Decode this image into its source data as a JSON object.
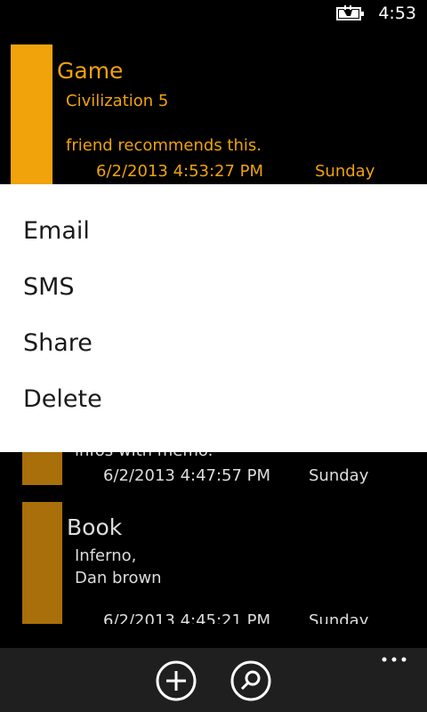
{
  "status": {
    "time": "4:53",
    "battery_icon": "battery-charging-icon"
  },
  "entries": [
    {
      "title": "Game",
      "text": "Civilization 5\n\nfriend recommends this.",
      "date": "6/2/2013 4:53:27 PM",
      "day": "Sunday",
      "color": "#F0A30A"
    },
    {
      "text": "infos with memo.",
      "date": "6/2/2013 4:47:57 PM",
      "day": "Sunday",
      "color": "#A86F0A"
    },
    {
      "title": "Book",
      "text": "Inferno,\nDan brown",
      "date": "6/2/2013 4:45:21 PM",
      "day": "Sunday",
      "color": "#A86F0A"
    }
  ],
  "context_menu": {
    "items": [
      "Email",
      "SMS",
      "Share",
      "Delete"
    ]
  },
  "app_bar": {
    "buttons": [
      {
        "icon": "add-icon"
      },
      {
        "icon": "search-icon"
      }
    ],
    "more_icon": "more-icon"
  },
  "colors": {
    "accent": "#F0A30A",
    "dimmed_accent": "#A86F0A",
    "background": "#000000",
    "menu_background": "#FFFFFF",
    "app_bar": "#1F1F1F"
  }
}
